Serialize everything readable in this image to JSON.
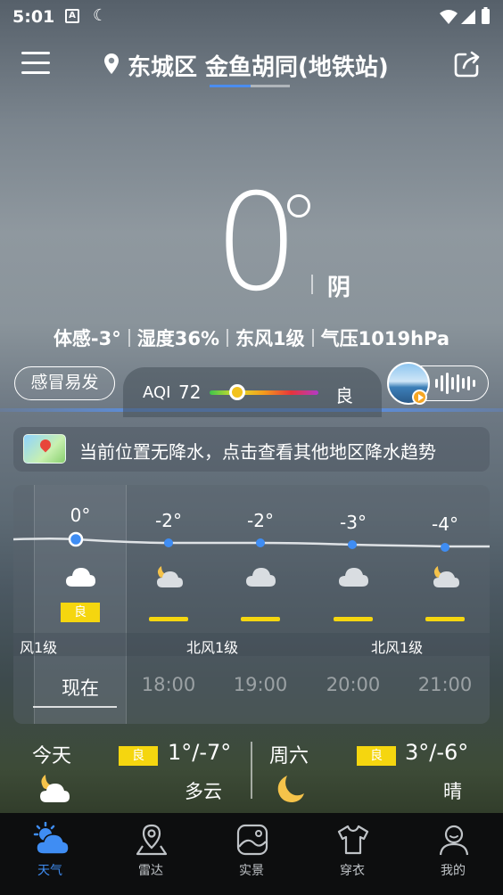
{
  "status_bar": {
    "time": "5:01",
    "a_label": "A"
  },
  "header": {
    "location": "东城区 金鱼胡同(地铁站)"
  },
  "current": {
    "temperature": "0",
    "condition": "阴",
    "details": [
      "体感-3°",
      "湿度36%",
      "东风1级",
      "气压1019hPa"
    ]
  },
  "flu": {
    "label": "感冒易发"
  },
  "aqi": {
    "label": "AQI",
    "value": "72",
    "level": "良"
  },
  "precipitation": {
    "text": "当前位置无降水，点击查看其他地区降水趋势"
  },
  "hourly": [
    {
      "temp": "0°",
      "time": "现在",
      "icon": "cloudy-icon",
      "aqi_badge": "良"
    },
    {
      "temp": "-2°",
      "time": "18:00",
      "icon": "partly-cloudy-night-icon"
    },
    {
      "temp": "-2°",
      "time": "19:00",
      "icon": "cloudy-icon"
    },
    {
      "temp": "-3°",
      "time": "20:00",
      "icon": "cloudy-icon"
    },
    {
      "temp": "-4°",
      "time": "21:00",
      "icon": "partly-cloudy-night-icon"
    }
  ],
  "wind_labels": [
    "风1级",
    "北风1级",
    "北风1级"
  ],
  "daily": [
    {
      "day": "今天",
      "aqi": "良",
      "temp": "1°/-7°",
      "desc": "多云",
      "icon": "partly-cloudy-night-icon"
    },
    {
      "day": "周六",
      "aqi": "良",
      "temp": "3°/-6°",
      "desc": "晴",
      "icon": "moon-icon"
    }
  ],
  "nav": [
    {
      "label": "天气",
      "icon": "weather-icon",
      "active": true
    },
    {
      "label": "雷达",
      "icon": "radar-location-icon"
    },
    {
      "label": "实景",
      "icon": "photo-icon"
    },
    {
      "label": "穿衣",
      "icon": "clothing-icon"
    },
    {
      "label": "我的",
      "icon": "profile-icon"
    }
  ],
  "colors": {
    "accent": "#3f8df3",
    "aqi_badge": "#f5d60f",
    "nav_bg": "#0d0e0f"
  }
}
